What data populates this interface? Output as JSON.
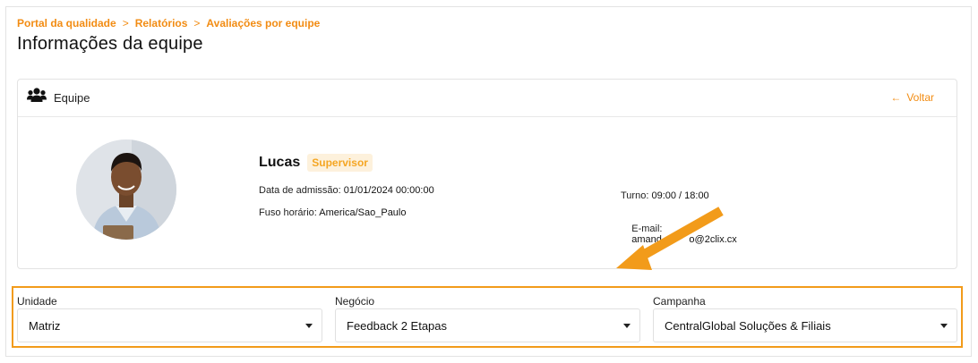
{
  "breadcrumb": {
    "items": [
      "Portal da qualidade",
      "Relatórios",
      "Avaliações por equipe"
    ],
    "separator": ">"
  },
  "page": {
    "title": "Informações da equipe"
  },
  "card": {
    "header_label": "Equipe",
    "back_label": "Voltar"
  },
  "profile": {
    "name": "Lucas",
    "role": "Supervisor",
    "admission_label": "Data de admissão:",
    "admission_value": "01/01/2024 00:00:00",
    "timezone_label": "Fuso horário:",
    "timezone_value": "America/Sao_Paulo",
    "shift_label": "Turno:",
    "shift_value": "09:00 / 18:00",
    "email_label": "E-mail:",
    "email_value": "amand          o@2clix.cx"
  },
  "filters": {
    "unit": {
      "label": "Unidade",
      "value": "Matriz"
    },
    "business": {
      "label": "Negócio",
      "value": "Feedback 2 Etapas"
    },
    "campaign": {
      "label": "Campanha",
      "value": "CentralGlobal Soluções & Filiais"
    }
  },
  "colors": {
    "accent": "#f28c13",
    "highlight_border": "#f29b1a",
    "badge_bg": "#fdf1dc",
    "badge_text": "#f5a623"
  },
  "icons": [
    "team-icon",
    "arrow-left-icon",
    "chevron-down-icon",
    "annotation-arrow-icon"
  ]
}
